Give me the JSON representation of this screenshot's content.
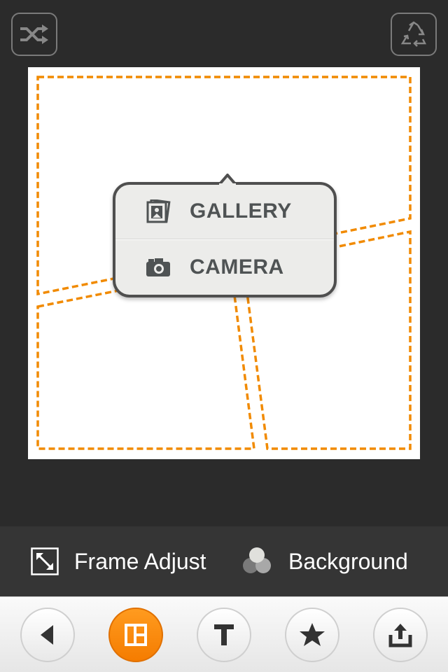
{
  "header": {
    "shuffle_icon": "shuffle-icon",
    "recycle_icon": "recycle-icon"
  },
  "popover": {
    "gallery_label": "GALLERY",
    "camera_label": "CAMERA"
  },
  "options": {
    "frame_adjust_label": "Frame Adjust",
    "background_label": "Background"
  },
  "toolbar": {
    "items": [
      "back-icon",
      "layout-icon",
      "text-icon",
      "star-icon",
      "share-icon"
    ],
    "active": "layout"
  },
  "colors": {
    "accent": "#f7901e",
    "frame_dash": "#f18a00",
    "background": "#2b2b2b"
  }
}
